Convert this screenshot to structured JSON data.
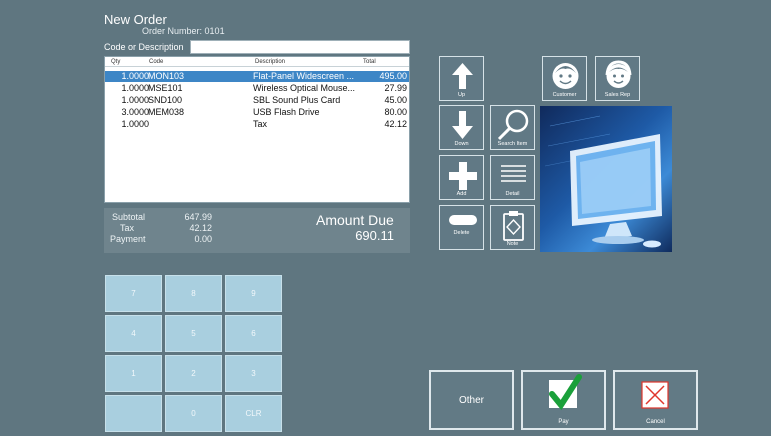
{
  "header": {
    "title": "New Order",
    "order_number_label": "Order Number:",
    "order_number": "0101",
    "code_label": "Code or Description",
    "code_value": ""
  },
  "grid": {
    "columns": [
      "Qty",
      "Code",
      "Description",
      "Total"
    ],
    "rows": [
      {
        "qty": "1.0000",
        "code": "MON103",
        "desc": "Flat-Panel Widescreen ...",
        "total": "495.00"
      },
      {
        "qty": "1.0000",
        "code": "MSE101",
        "desc": "Wireless Optical Mouse...",
        "total": "27.99"
      },
      {
        "qty": "1.0000",
        "code": "SND100",
        "desc": "SBL Sound Plus Card",
        "total": "45.00"
      },
      {
        "qty": "3.0000",
        "code": "MEM038",
        "desc": "USB Flash Drive",
        "total": "80.00"
      },
      {
        "qty": "1.0000",
        "code": "",
        "desc": "Tax",
        "total": "42.12"
      }
    ]
  },
  "totals": {
    "subtotal_label": "Subtotal",
    "subtotal": "647.99",
    "tax_label": "Tax",
    "tax": "42.12",
    "payment_label": "Payment",
    "payment": "0.00",
    "amount_due_label": "Amount Due",
    "amount_due": "690.11"
  },
  "keypad": {
    "keys": [
      "7",
      "8",
      "9",
      "4",
      "5",
      "6",
      "1",
      "2",
      "3",
      "",
      "0",
      "CLR"
    ]
  },
  "actions": {
    "up": "Up",
    "down": "Down",
    "add": "Add",
    "delete": "Delete",
    "search_item": "Search Item",
    "detail": "Detail",
    "note": "Note",
    "customer": "Customer",
    "sales_rep": "Sales Rep"
  },
  "bottom": {
    "other": "Other",
    "pay": "Pay",
    "cancel": "Cancel"
  },
  "icons": {
    "up": "arrow-up-icon",
    "down": "arrow-down-icon",
    "add": "plus-icon",
    "delete": "minus-icon",
    "search": "magnifier-icon",
    "detail": "list-lines-icon",
    "note": "clipboard-icon",
    "customer": "person-icon",
    "sales_rep": "person-headset-icon",
    "pay": "check-icon",
    "cancel": "x-icon"
  },
  "colors": {
    "background": "#5f7680",
    "selected_row": "#3d86c6",
    "keypad": "#a9cfdf",
    "check": "#1aa03a",
    "cancel_x": "#e0362c"
  }
}
